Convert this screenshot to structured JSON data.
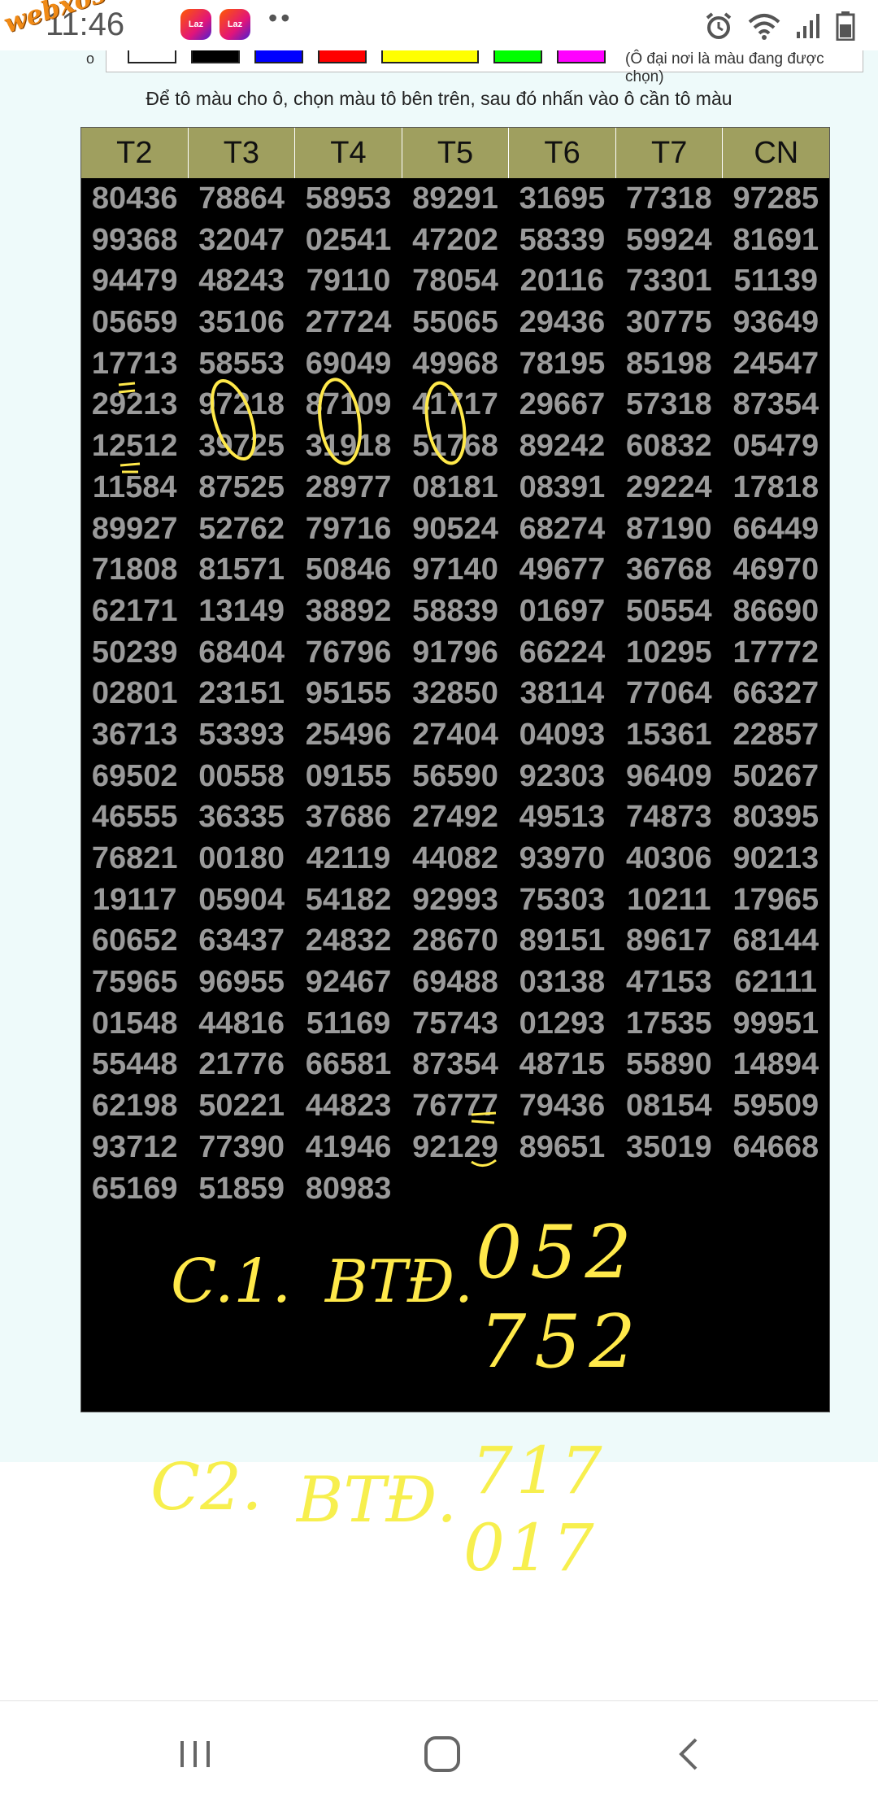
{
  "status": {
    "time": "11:46",
    "watermark": "webxoso.net",
    "app_badge_1": "Laz",
    "app_badge_2": "Laz",
    "more": "••"
  },
  "palette": {
    "label": "o",
    "note": "(Ô đại nơi là màu đang được chọn)",
    "swatches": [
      "#ffffff",
      "#000000",
      "#0000ff",
      "#ff0000",
      "#ffff00",
      "#00ff00",
      "#ff00ff"
    ]
  },
  "instruction": "Để tô màu cho ô, chọn màu tô bên trên, sau đó nhấn vào ô cần tô màu",
  "table": {
    "headers": [
      "T2",
      "T3",
      "T4",
      "T5",
      "T6",
      "T7",
      "CN"
    ],
    "rows": [
      [
        "80436",
        "78864",
        "58953",
        "89291",
        "31695",
        "77318",
        "97285"
      ],
      [
        "99368",
        "32047",
        "02541",
        "47202",
        "58339",
        "59924",
        "81691"
      ],
      [
        "94479",
        "48243",
        "79110",
        "78054",
        "20116",
        "73301",
        "51139"
      ],
      [
        "05659",
        "35106",
        "27724",
        "55065",
        "29436",
        "30775",
        "93649"
      ],
      [
        "17713",
        "58553",
        "69049",
        "49968",
        "78195",
        "85198",
        "24547"
      ],
      [
        "29213",
        "97218",
        "87109",
        "41717",
        "29667",
        "57318",
        "87354"
      ],
      [
        "12512",
        "39725",
        "31918",
        "51768",
        "89242",
        "60832",
        "05479"
      ],
      [
        "11584",
        "87525",
        "28977",
        "08181",
        "08391",
        "29224",
        "17818"
      ],
      [
        "89927",
        "52762",
        "79716",
        "90524",
        "68274",
        "87190",
        "66449"
      ],
      [
        "71808",
        "81571",
        "50846",
        "97140",
        "49677",
        "36768",
        "46970"
      ],
      [
        "62171",
        "13149",
        "38892",
        "58839",
        "01697",
        "50554",
        "86690"
      ],
      [
        "50239",
        "68404",
        "76796",
        "91796",
        "66224",
        "10295",
        "17772"
      ],
      [
        "02801",
        "23151",
        "95155",
        "32850",
        "38114",
        "77064",
        "66327"
      ],
      [
        "36713",
        "53393",
        "25496",
        "27404",
        "04093",
        "15361",
        "22857"
      ],
      [
        "69502",
        "00558",
        "09155",
        "56590",
        "92303",
        "96409",
        "50267"
      ],
      [
        "46555",
        "36335",
        "37686",
        "27492",
        "49513",
        "74873",
        "80395"
      ],
      [
        "76821",
        "00180",
        "42119",
        "44082",
        "93970",
        "40306",
        "90213"
      ],
      [
        "19117",
        "05904",
        "54182",
        "92993",
        "75303",
        "10211",
        "17965"
      ],
      [
        "60652",
        "63437",
        "24832",
        "28670",
        "89151",
        "89617",
        "68144"
      ],
      [
        "75965",
        "96955",
        "92467",
        "69488",
        "03138",
        "47153",
        "62111"
      ],
      [
        "01548",
        "44816",
        "51169",
        "75743",
        "01293",
        "17535",
        "99951"
      ],
      [
        "55448",
        "21776",
        "66581",
        "87354",
        "48715",
        "55890",
        "14894"
      ],
      [
        "62198",
        "50221",
        "44823",
        "76777",
        "79436",
        "08154",
        "59509"
      ],
      [
        "93712",
        "77390",
        "41946",
        "92129",
        "89651",
        "35019",
        "64668"
      ],
      [
        "65169",
        "51859",
        "80983",
        "",
        "",
        "",
        ""
      ]
    ]
  },
  "notes": {
    "c1_label": "C.1.",
    "c1_btd": "BTĐ.",
    "c1_line1": "052",
    "c1_line2": "752",
    "c2_label": "C2.",
    "c2_btd": "BTĐ.",
    "c2_line1": "717",
    "c2_line2": "017"
  },
  "colors": {
    "header_bg": "#9f9f5f",
    "grid_bg": "#000000",
    "cell_text": "#9a9a9a",
    "annotation": "#ffe94a",
    "page_bg": "#eefafa"
  }
}
